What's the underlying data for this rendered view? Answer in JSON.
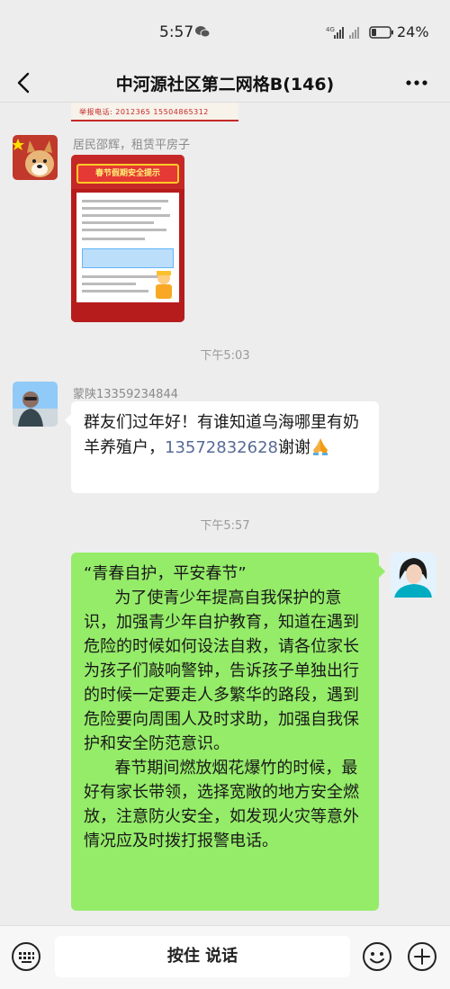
{
  "status_bar": {
    "time": "5:57",
    "battery_percent": "24%",
    "network_label": "4G"
  },
  "header": {
    "title": "中河源社区第二网格B(146)",
    "back_icon": "chevron-left-icon",
    "more_icon": "more-dots-icon"
  },
  "chat": {
    "previous_image_caption": "举报电话: 2012365  15504865312",
    "messages": [
      {
        "type": "image",
        "side": "left",
        "sender": "居民邵辉，租赁平房子",
        "poster_title": "春节假期安全提示"
      },
      {
        "type": "timestamp",
        "text": "下午5:03"
      },
      {
        "type": "text",
        "side": "left",
        "sender": "蒙陕13359234844",
        "text_before": "群友们过年好！有谁知道乌海哪里有奶羊养殖户，",
        "phone": "13572832628",
        "text_after": "谢谢"
      },
      {
        "type": "timestamp",
        "text": "下午5:57"
      },
      {
        "type": "text",
        "side": "right",
        "paragraphs": [
          "“青春自护，平安春节”",
          "      为了使青少年提高自我保护的意识，加强青少年自护教育，知道在遇到危险的时候如何设法自救，请各位家长为孩子们敲响警钟，告诉孩子单独出行的时候一定要走人多繁华的路段，遇到危险要向周围人及时求助，加强自我保护和安全防范意识。",
          "      春节期间燃放烟花爆竹的时候，最好有家长带领，选择宽敞的地方安全燃放，注意防火安全，如发现火灾等意外情况应及时拨打报警电话。"
        ]
      }
    ]
  },
  "input_bar": {
    "talk_label": "按住 说话",
    "keyboard_icon": "keyboard-icon",
    "emoji_icon": "emoji-icon",
    "plus_icon": "plus-circle-icon"
  },
  "colors": {
    "background": "#ededed",
    "self_bubble": "#95ec69",
    "other_bubble": "#ffffff",
    "link": "#576b95"
  }
}
